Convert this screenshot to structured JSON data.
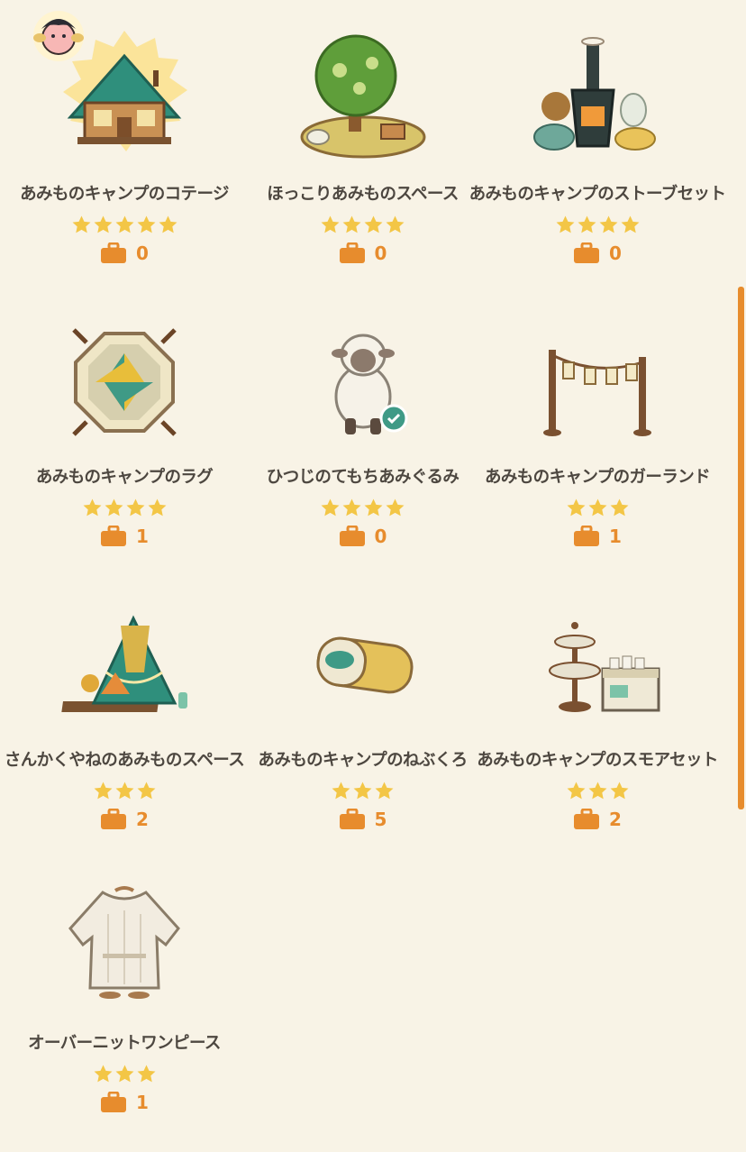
{
  "colors": {
    "background": "#f8f3e6",
    "text": "#4d4740",
    "star": "#f3c646",
    "accent": "#e78c2d"
  },
  "items": [
    {
      "name": "あみものキャンプのコテージ",
      "stars": 5,
      "count": "0",
      "icon": "cottage-icon",
      "featured": true
    },
    {
      "name": "ほっこりあみものスペース",
      "stars": 4,
      "count": "0",
      "icon": "tree-space-icon"
    },
    {
      "name": "あみものキャンプのストーブセット",
      "stars": 4,
      "count": "0",
      "icon": "stove-set-icon"
    },
    {
      "name": "あみものキャンプのラグ",
      "stars": 4,
      "count": "1",
      "icon": "rug-icon"
    },
    {
      "name": "ひつじのてもちあみぐるみ",
      "stars": 4,
      "count": "0",
      "icon": "sheep-plush-icon"
    },
    {
      "name": "あみものキャンプのガーランド",
      "stars": 3,
      "count": "1",
      "icon": "garland-icon"
    },
    {
      "name": "さんかくやねのあみものスペース",
      "stars": 3,
      "count": "2",
      "icon": "tent-space-icon"
    },
    {
      "name": "あみものキャンプのねぶくろ",
      "stars": 3,
      "count": "5",
      "icon": "sleeping-bag-icon"
    },
    {
      "name": "あみものキャンプのスモアセット",
      "stars": 3,
      "count": "2",
      "icon": "smore-set-icon"
    },
    {
      "name": "オーバーニットワンピース",
      "stars": 3,
      "count": "1",
      "icon": "knit-dress-icon"
    }
  ]
}
